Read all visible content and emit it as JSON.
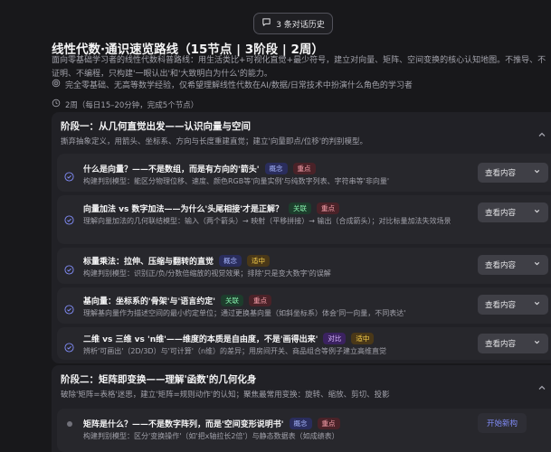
{
  "history": {
    "label": "3 条对话历史",
    "icon": "chat-bubble-icon"
  },
  "header": {
    "title": "线性代数·通识速览路线（15节点 | 3阶段 | 2周）",
    "description": "面向零基础学习者的线性代数科普路线：用生活类比+可视化直觉+最少符号，建立对向量、矩阵、空间变换的核心认知地图。不推导、不证明、不编程，只构建'一眼认出'和'大致明白为什么'的能力。",
    "audience": "完全零基础、无高等数学经验，仅希望理解线性代数在AI/数据/日常技术中扮演什么角色的学习者",
    "duration": "2周（每日15–20分钟，完成5个节点）"
  },
  "stages": [
    {
      "title": "阶段一：从几何直觉出发——认识向量与空间",
      "subtitle": "撕弃抽象定义，用箭头、坐标系、方向与长度重建直觉；建立'向量即点/位移'的判别模型。",
      "nodes": [
        {
          "title": "什么是向量？——不是数组，而是有方向的'箭头'",
          "tags": [
            {
              "text": "概念",
              "kind": "concept"
            },
            {
              "text": "重点",
              "kind": "key"
            }
          ],
          "subtitle": "构建判别模型：能区分物理位移、速度、颜色RGB等'向量实例'与纯数字列表、字符串等'非向量'",
          "action": "查看内容"
        },
        {
          "title": "向量加法 vs 数字加法——为什么'头尾相接'才是正解？",
          "tags": [
            {
              "text": "关联",
              "kind": "related"
            },
            {
              "text": "重点",
              "kind": "key"
            }
          ],
          "subtitle": "理解向量加法的几何联结模型：输入（两个箭头）→ 映射（平移拼接）→ 输出（合成箭头）；对比标量加法失效场景",
          "action": "查看内容"
        },
        {
          "title": "标量乘法：拉伸、压缩与翻转的直觉",
          "tags": [
            {
              "text": "概念",
              "kind": "concept"
            },
            {
              "text": "适中",
              "kind": "mid"
            }
          ],
          "subtitle": "构建判别模型：识别正/负/分数倍缩放的视觉效果；排除'只是变大数字'的误解",
          "action": "查看内容"
        },
        {
          "title": "基向量：坐标系的'骨架'与'语言约定'",
          "tags": [
            {
              "text": "关联",
              "kind": "related"
            },
            {
              "text": "重点",
              "kind": "key"
            }
          ],
          "subtitle": "理解基向量作为描述空间的最小约定单位；通过更换基向量（如斜坐标系）体会'同一向量，不同表达'",
          "action": "查看内容"
        },
        {
          "title": "二维 vs 三维 vs 'n维'——维度的本质是自由度，不是'画得出来'",
          "tags": [
            {
              "text": "对比",
              "kind": "compare"
            },
            {
              "text": "适中",
              "kind": "mid"
            }
          ],
          "subtitle": "辨析'可画出'（2D/3D）与'可计算'（n维）的差异；用房间开关、商品组合等例子建立高维直觉",
          "action": "查看内容"
        }
      ]
    },
    {
      "title": "阶段二：矩阵即变换——理解'函数'的几何化身",
      "subtitle": "破除'矩阵=表格'迷思，建立'矩阵=规则动作'的认知；聚焦最常用变换：旋转、缩放、剪切、投影",
      "nodes": [
        {
          "title": "矩阵是什么？——不是数字阵列，而是'空间变形说明书'",
          "tags": [
            {
              "text": "概念",
              "kind": "concept"
            },
            {
              "text": "重点",
              "kind": "key"
            }
          ],
          "subtitle": "构建判别模型：区分'变换操作'（如'把x轴拉长2倍'）与静态数据表（如成绩表）",
          "action": "开始新构"
        }
      ]
    }
  ]
}
